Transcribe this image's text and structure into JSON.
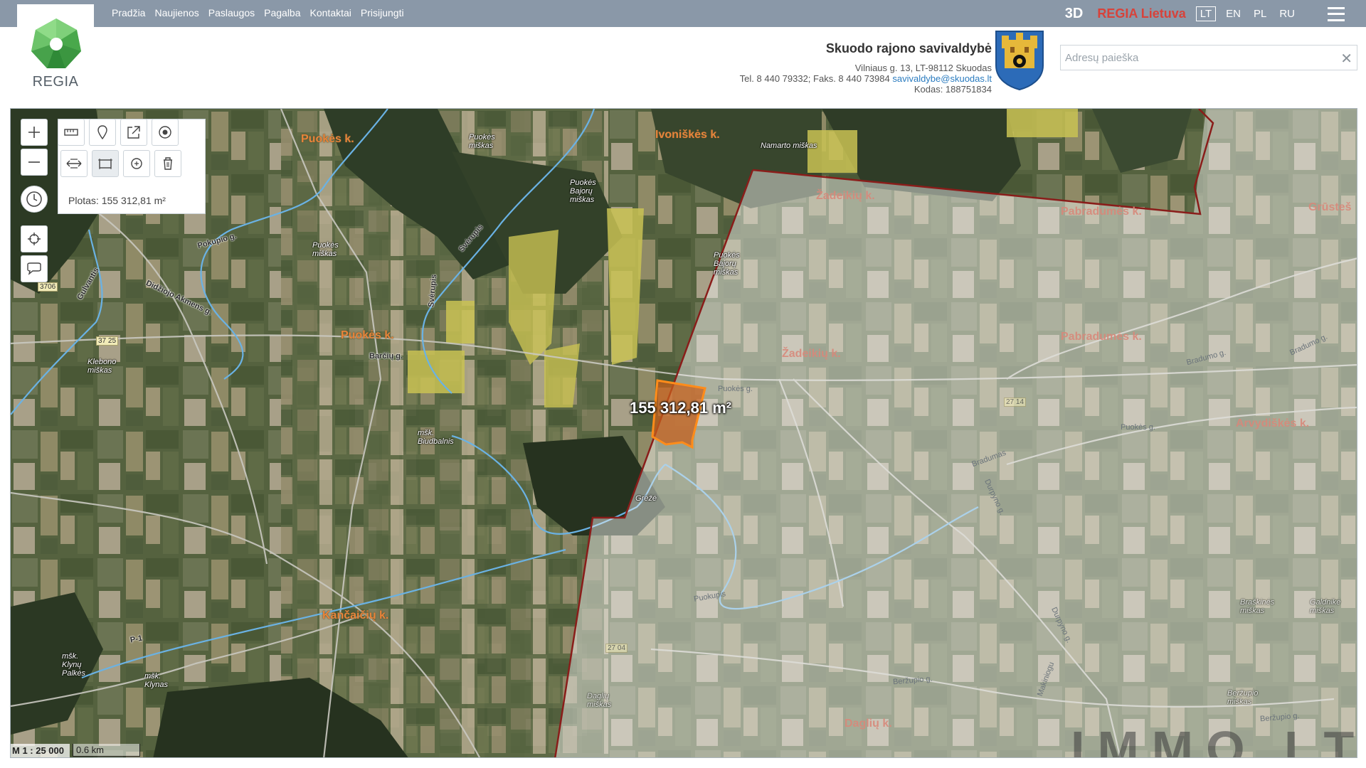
{
  "app": {
    "logo_text": "REGIA"
  },
  "nav": {
    "items": [
      "Pradžia",
      "Naujienos",
      "Paslaugos",
      "Pagalba",
      "Kontaktai",
      "Prisijungti"
    ],
    "btn_3d": "3D",
    "regia_lietuva": "REGIA Lietuva",
    "languages": [
      {
        "code": "LT",
        "active": true
      },
      {
        "code": "EN",
        "active": false
      },
      {
        "code": "PL",
        "active": false
      },
      {
        "code": "RU",
        "active": false
      }
    ]
  },
  "municipality": {
    "name": "Skuodo rajono savivaldybė",
    "address": "Vilniaus g. 13, LT-98112 Skuodas",
    "phone": "Tel. 8 440 79332; Faks. 8 440 73984",
    "email": "savivaldybe@skuodas.lt",
    "code": "Kodas: 188751834"
  },
  "search": {
    "placeholder": "Adresų paieška",
    "value": ""
  },
  "tools": {
    "area_result": "Plotas: 155 312,81 m²",
    "icons": [
      "zoom-in-icon",
      "zoom-out-icon",
      "ruler-icon",
      "location-pin-icon",
      "share-icon",
      "target-icon",
      "measure-distance-icon",
      "measure-area-icon",
      "measure-clear-icon",
      "trash-icon",
      "history-icon",
      "crosshair-icon",
      "speech-bubble-icon"
    ]
  },
  "map": {
    "area_label": "155 312,81 m²",
    "villages": [
      "Puokės k.",
      "Ivoniškės k.",
      "Puokės k.",
      "Žadeikių k.",
      "Pabradumės k.",
      "Pabradumės k.",
      "Žadeikių k.",
      "Arvydiškės k.",
      "Kančaičių k.",
      "Daglių k.",
      "Grūsteš"
    ],
    "places": [
      "Puokės miškas",
      "Puokės miškas",
      "Puokės Bajorų miškas",
      "Puokės Bajorų miškas",
      "Namarto miškas",
      "Klebono miškas",
      "mšk. Biudbalnis",
      "Grėžė",
      "mšk. Klynų Palkės",
      "mšk. Klynas",
      "Daglių miškas",
      "Braškinės miškas",
      "Galdnikė miškas",
      "Beržupio miškas"
    ],
    "roads": [
      "Barčių g.",
      "Puokės g.",
      "Puokės g.",
      "Gulvantis",
      "Svėrupis",
      "Svėrupis",
      "Pokupio g.",
      "Didžiojo Akmens g.",
      "Bradumas",
      "Bradumo g.",
      "Bradumo g.",
      "Durpyno g.",
      "Durpyno g.",
      "Puokupis",
      "Beržupio g.",
      "Beržupio g.",
      "P-1",
      "Makiniogu"
    ],
    "road_numbers": [
      "3706",
      "37 25",
      "27 14",
      "27 04"
    ],
    "scale_ratio": "M 1 : 25 000",
    "scale_distance": "0.6 km",
    "watermark": "IMMO.LT"
  }
}
